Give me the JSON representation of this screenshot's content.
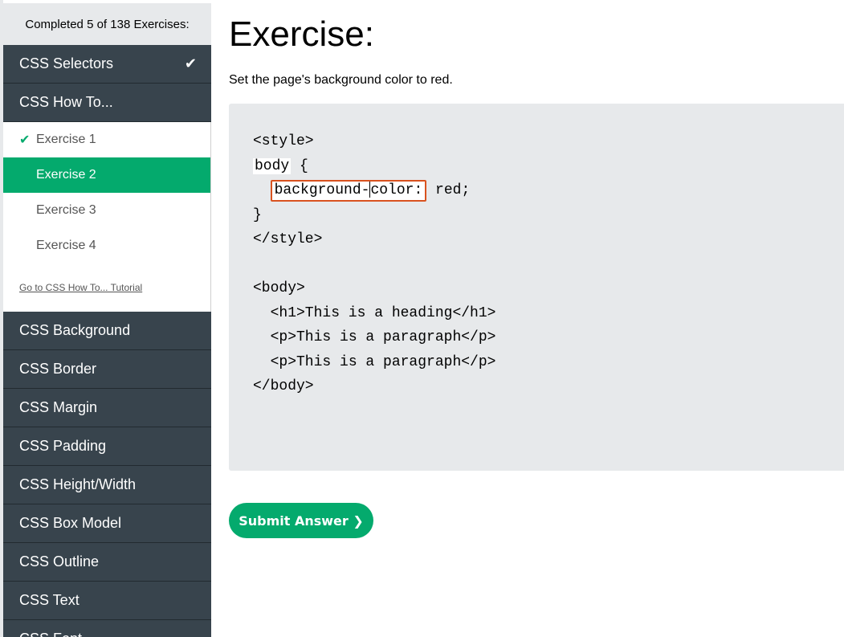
{
  "sidebar": {
    "progress_text": "Completed 5 of 138 Exercises:",
    "categories_top": [
      {
        "label": "CSS Selectors",
        "completed": true
      },
      {
        "label": "CSS How To...",
        "completed": false
      }
    ],
    "sub_items": [
      {
        "label": "Exercise 1",
        "done": true
      },
      {
        "label": "Exercise 2",
        "active": true
      },
      {
        "label": "Exercise 3"
      },
      {
        "label": "Exercise 4"
      }
    ],
    "tutorial_link": "Go to CSS How To... Tutorial",
    "categories_bottom": [
      "CSS Background",
      "CSS Border",
      "CSS Margin",
      "CSS Padding",
      "CSS Height/Width",
      "CSS Box Model",
      "CSS Outline",
      "CSS Text",
      "CSS Font"
    ]
  },
  "main": {
    "title": "Exercise:",
    "instruction": "Set the page's background color to red.",
    "code": {
      "line1": "<style>",
      "line2_selector": "body",
      "line2_brace": " {",
      "line3_indent": "  ",
      "line3_input_before": "background-",
      "line3_input_after": "color:",
      "line3_rest": " red;",
      "line4": "}",
      "line5": "</style>",
      "line6": "",
      "line7": "<body>",
      "line8": "  <h1>This is a heading</h1>",
      "line9": "  <p>This is a paragraph</p>",
      "line10": "  <p>This is a paragraph</p>",
      "line11": "</body>"
    },
    "submit_label": "Submit Answer ❯"
  },
  "colors": {
    "accent": "#04aa6d",
    "sidebar_bg": "#38444d",
    "code_bg": "#e7e9eb",
    "input_border": "#d9521f"
  }
}
